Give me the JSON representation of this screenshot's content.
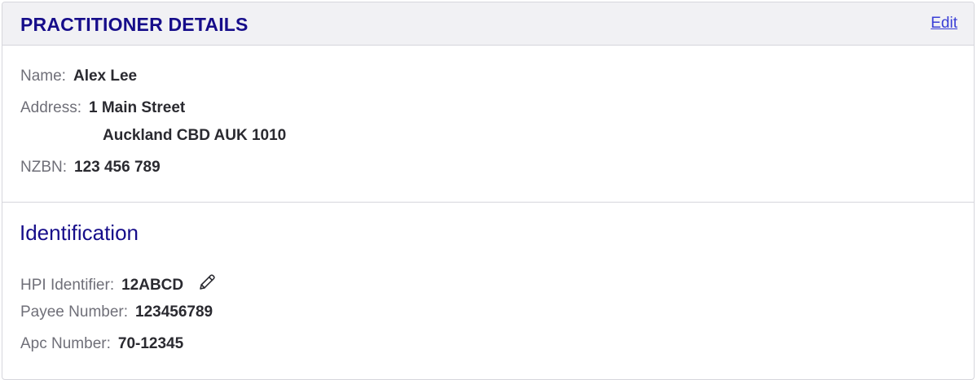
{
  "header": {
    "title": "PRACTITIONER DETAILS",
    "edit_label": "Edit"
  },
  "details": {
    "name_label": "Name:",
    "name_value": "Alex Lee",
    "address_label": "Address:",
    "address_line1": "1 Main Street",
    "address_line2": "Auckland CBD AUK 1010",
    "nzbn_label": "NZBN:",
    "nzbn_value": "123 456 789"
  },
  "identification": {
    "title": "Identification",
    "hpi_label": "HPI Identifier:",
    "hpi_value": "12ABCD",
    "payee_label": "Payee Number:",
    "payee_value": "123456789",
    "apc_label": "Apc Number:",
    "apc_value": "70-12345",
    "edit_icon": "pencil-icon"
  },
  "colors": {
    "title": "#160d8a",
    "link": "#3a3fd6",
    "label": "#6f6f78",
    "value": "#2a2a30",
    "header_bg": "#f1f1f4",
    "border": "#d6d6dc"
  }
}
